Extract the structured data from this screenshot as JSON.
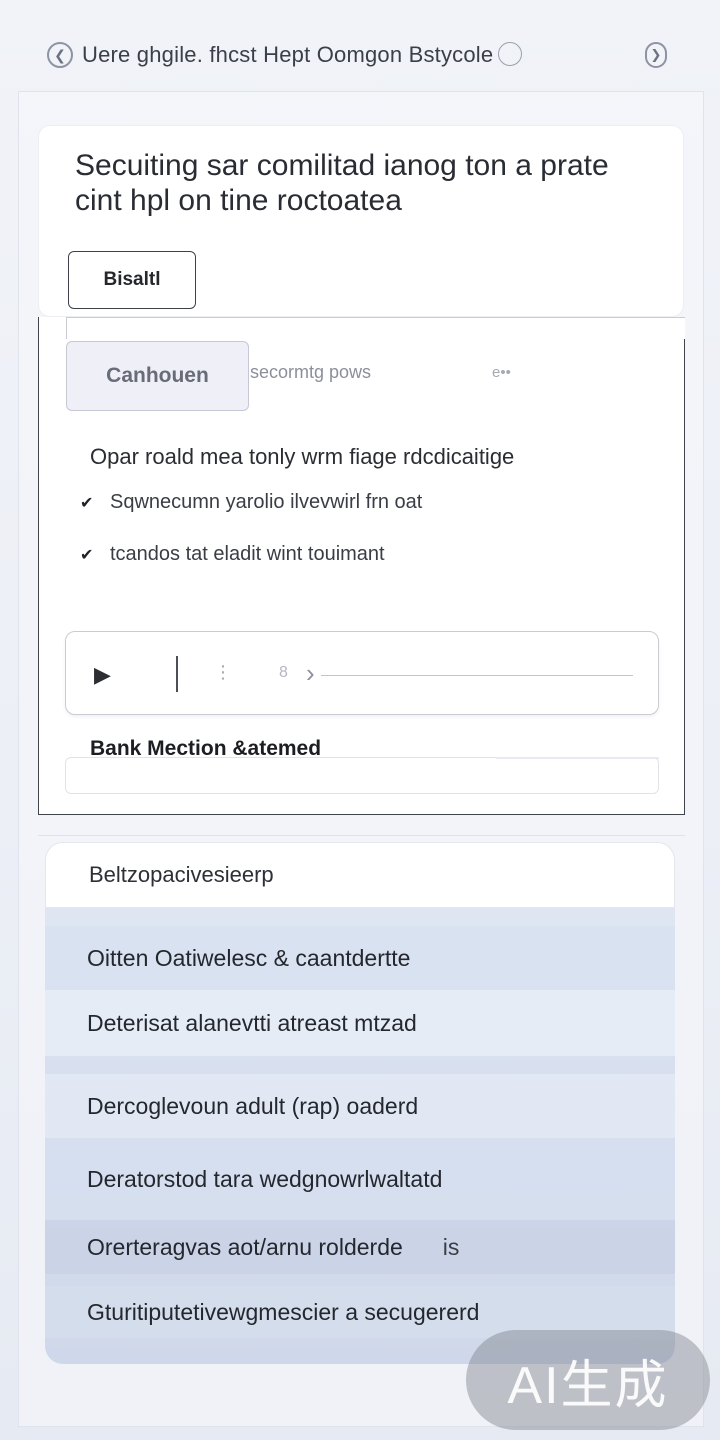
{
  "header": {
    "title": "Uere ghgile. fhcst Hept Oomgon Bstycole",
    "back_icon": "chevron-left-icon",
    "forward_icon": "chevron-right-icon"
  },
  "hero": {
    "heading": "Secuiting sar comilitad ianog ton a prate cint hpl on tine roctoatea",
    "button_label": "Bisaltl"
  },
  "panel": {
    "tabs": {
      "active": "Canhouen",
      "secondary": "secormtg pows",
      "more": "e••"
    },
    "lead": "Opar roald mea tonly wrm fiage rdcdicaitige",
    "checklist": [
      "Sqwnecumn yarolio ilvevwirl frn oat",
      "tcandos tat eladit wint touimant"
    ],
    "player": {
      "speed": "8"
    },
    "section_label": "Bank Mection &atemed"
  },
  "list": {
    "header": "Beltzopacivesieerp",
    "items": [
      "Oitten Oatiwelesc & caantdertte",
      "Deterisat alanevtti atreast mtzad",
      "Dercoglevoun adult (rap) oaderd",
      "Deratorstod tara wedgnowrlwaltatd",
      "Orerteragvas aot/arnu rolderde",
      "Gturitiputetivewgmescier a secugererd"
    ],
    "item_tail": "is"
  },
  "watermark": "AI生成",
  "colors": {
    "background": "#eceff6",
    "card": "#ffffff",
    "list_fill": "#d6dfee",
    "text": "#1d1f24"
  }
}
